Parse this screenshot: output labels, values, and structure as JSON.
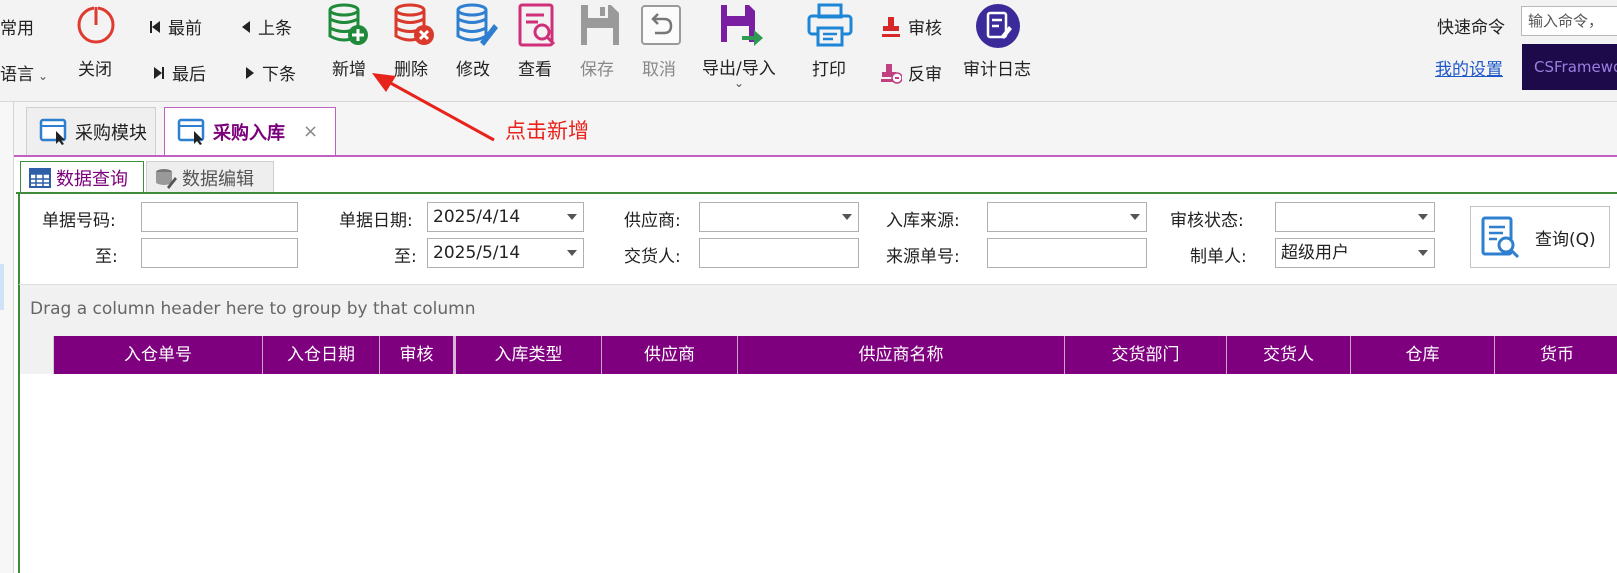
{
  "toolbar": {
    "common": "常用",
    "language": "语言",
    "close": "关闭",
    "first": "最前",
    "prev": "上条",
    "last": "最后",
    "next": "下条",
    "add": "新增",
    "delete": "删除",
    "edit": "修改",
    "view": "查看",
    "save": "保存",
    "cancel": "取消",
    "export_import": "导出/导入",
    "print": "打印",
    "approve": "审核",
    "unapprove": "反审",
    "audit_log": "审计日志",
    "quick_cmd_label": "快速命令",
    "quick_cmd_placeholder": "输入命令，",
    "my_settings": "我的设置",
    "brand_text": "CSFramework"
  },
  "tabs": [
    {
      "label": "采购模块"
    },
    {
      "label": "采购入库",
      "close": "×"
    }
  ],
  "subtabs": [
    {
      "label": "数据查询"
    },
    {
      "label": "数据编辑"
    }
  ],
  "filters": {
    "doc_no_label": "单据号码:",
    "to_label": "至:",
    "doc_date_label": "单据日期:",
    "doc_date_from": "2025/4/14",
    "doc_date_to": "2025/5/14",
    "supplier_label": "供应商:",
    "deliverer_label": "交货人:",
    "source_label": "入库来源:",
    "source_no_label": "来源单号:",
    "status_label": "审核状态:",
    "maker_label": "制单人:",
    "maker_value": "超级用户",
    "query_button": "查询(Q)"
  },
  "grid": {
    "group_hint": "Drag a column header here to group by that column",
    "columns": [
      "入仓单号",
      "入仓日期",
      "审核",
      "入库类型",
      "供应商",
      "供应商名称",
      "交货部门",
      "交货人",
      "仓库",
      "货币"
    ]
  },
  "annotation": {
    "text": "点击新增",
    "color": "#e8231c"
  },
  "colors": {
    "header_purple": "#7f007f",
    "tab_active": "#7b007b",
    "green_border": "#3c8c3c"
  }
}
